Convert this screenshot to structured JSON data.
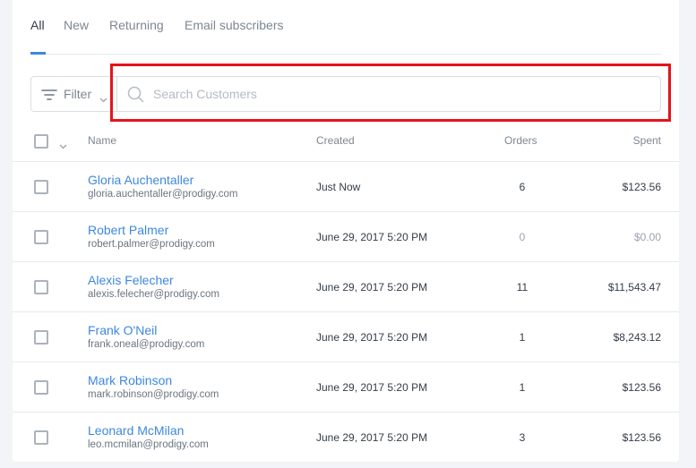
{
  "tabs": [
    {
      "label": "All",
      "active": true
    },
    {
      "label": "New",
      "active": false
    },
    {
      "label": "Returning",
      "active": false
    },
    {
      "label": "Email subscribers",
      "active": false
    }
  ],
  "filter": {
    "label": "Filter"
  },
  "search": {
    "placeholder": "Search Customers",
    "value": ""
  },
  "table": {
    "headers": {
      "name": "Name",
      "created": "Created",
      "orders": "Orders",
      "spent": "Spent"
    },
    "rows": [
      {
        "name": "Gloria Auchentaller",
        "email": "gloria.auchentaller@prodigy.com",
        "created": "Just Now",
        "orders": "6",
        "spent": "$123.56"
      },
      {
        "name": "Robert Palmer",
        "email": "robert.palmer@prodigy.com",
        "created": "June 29, 2017 5:20 PM",
        "orders": "0",
        "spent": "$0.00"
      },
      {
        "name": "Alexis Felecher",
        "email": "alexis.felecher@prodigy.com",
        "created": "June 29, 2017 5:20 PM",
        "orders": "11",
        "spent": "$11,543.47"
      },
      {
        "name": "Frank O'Neil",
        "email": "frank.oneal@prodigy.com",
        "created": "June 29, 2017 5:20 PM",
        "orders": "1",
        "spent": "$8,243.12"
      },
      {
        "name": "Mark Robinson",
        "email": "mark.robinson@prodigy.com",
        "created": "June 29, 2017 5:20 PM",
        "orders": "1",
        "spent": "$123.56"
      },
      {
        "name": "Leonard McMilan",
        "email": "leo.mcmilan@prodigy.com",
        "created": "June 29, 2017 5:20 PM",
        "orders": "3",
        "spent": "$123.56"
      }
    ]
  },
  "colors": {
    "accent": "#3e88df",
    "highlight": "#e4141b"
  },
  "icons": {
    "filter": "filter-lines-icon",
    "search": "magnifier-icon",
    "chevron": "chevron-down-icon"
  }
}
